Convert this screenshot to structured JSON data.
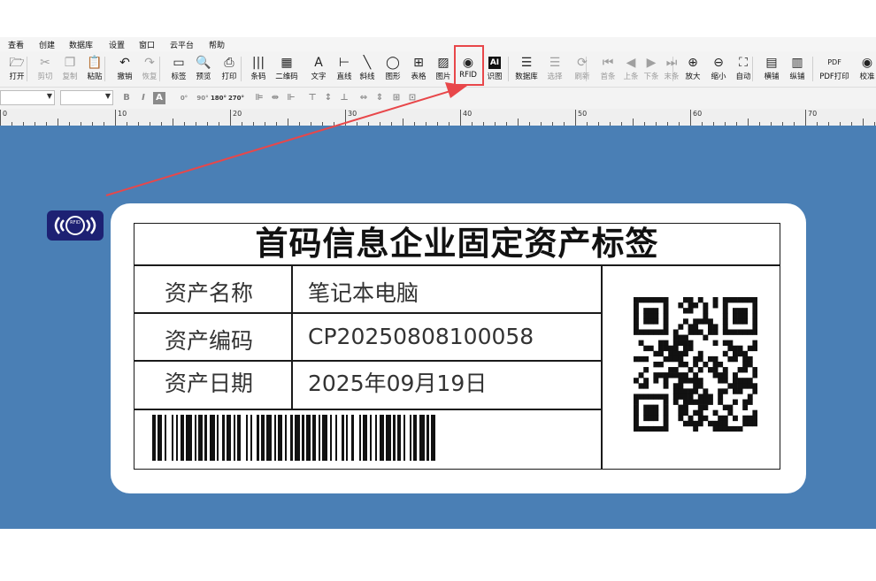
{
  "menu": [
    "查看",
    "创建",
    "数据库",
    "设置",
    "窗口",
    "云平台",
    "帮助"
  ],
  "toolbar": {
    "items": [
      {
        "label": "打开",
        "icon": "open-folder-icon"
      },
      {
        "label": "剪切",
        "icon": "scissors-icon"
      },
      {
        "label": "复制",
        "icon": "copy-icon"
      },
      {
        "label": "粘贴",
        "icon": "paste-icon"
      },
      {
        "label": "撤销",
        "icon": "undo-icon"
      },
      {
        "label": "恢复",
        "icon": "redo-icon"
      },
      {
        "label": "标签",
        "icon": "label-icon"
      },
      {
        "label": "预览",
        "icon": "preview-icon"
      },
      {
        "label": "打印",
        "icon": "printer-icon"
      },
      {
        "label": "条码",
        "icon": "barcode-icon"
      },
      {
        "label": "二维码",
        "icon": "qrcode-icon"
      },
      {
        "label": "文字",
        "icon": "text-icon"
      },
      {
        "label": "直线",
        "icon": "line-icon"
      },
      {
        "label": "斜线",
        "icon": "diagonal-line-icon"
      },
      {
        "label": "图形",
        "icon": "shape-icon"
      },
      {
        "label": "表格",
        "icon": "table-icon"
      },
      {
        "label": "图片",
        "icon": "image-icon"
      },
      {
        "label": "RFID",
        "icon": "rfid-icon"
      },
      {
        "label": "识图",
        "icon": "ai-icon"
      },
      {
        "label": "数据库",
        "icon": "database-icon"
      },
      {
        "label": "选择",
        "icon": "select-icon"
      },
      {
        "label": "刷新",
        "icon": "refresh-icon"
      },
      {
        "label": "首条",
        "icon": "first-record-icon"
      },
      {
        "label": "上条",
        "icon": "previous-record-icon"
      },
      {
        "label": "下条",
        "icon": "next-record-icon"
      },
      {
        "label": "末条",
        "icon": "last-record-icon"
      },
      {
        "label": "放大",
        "icon": "zoom-in-icon"
      },
      {
        "label": "缩小",
        "icon": "zoom-out-icon"
      },
      {
        "label": "自动",
        "icon": "fit-icon"
      },
      {
        "label": "横铺",
        "icon": "horizontal-layout-icon"
      },
      {
        "label": "纵铺",
        "icon": "vertical-layout-icon"
      },
      {
        "label": "PDF打印",
        "icon": "pdf-print-icon"
      },
      {
        "label": "校准",
        "icon": "calibrate-icon"
      }
    ]
  },
  "format_bar": {
    "bold": "B",
    "italic": "I",
    "text_box": "A",
    "rotate": [
      "0°",
      "90°",
      "180°",
      "270°"
    ]
  },
  "ruler": [
    "0",
    "10",
    "20",
    "30",
    "40",
    "50",
    "60",
    "70"
  ],
  "label": {
    "title": "首码信息企业固定资产标签",
    "rows": [
      {
        "key": "资产名称",
        "value": "笔记本电脑"
      },
      {
        "key": "资产编码",
        "value": "CP20250808100058"
      },
      {
        "key": "资产日期",
        "value": "2025年09月19日"
      }
    ],
    "rfid_badge_text": "RFID"
  },
  "colors": {
    "canvas": "#4a7fb5",
    "highlight": "#e8474a",
    "rfid_badge": "#1d2173"
  }
}
